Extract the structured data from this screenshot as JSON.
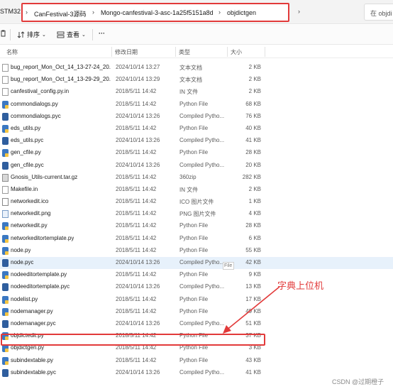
{
  "address": {
    "prefix": "STM32",
    "crumbs": [
      "CanFestival-3源码",
      "Mongo-canfestival-3-asc-1a25f5151a8d",
      "objdictgen"
    ],
    "search_placeholder": "在 objdi"
  },
  "toolbar": {
    "sort_label": "排序",
    "view_label": "查看",
    "more_label": "···"
  },
  "columns": {
    "name": "名称",
    "date": "修改日期",
    "type": "类型",
    "size": "大小"
  },
  "files": [
    {
      "name": "bug_report_Mon_Oct_14_13-27-24_20...",
      "date": "2024/10/14 13:27",
      "type": "文本文档",
      "size": "2 KB",
      "icon": "doc"
    },
    {
      "name": "bug_report_Mon_Oct_14_13-29-29_20...",
      "date": "2024/10/14 13:29",
      "type": "文本文档",
      "size": "2 KB",
      "icon": "doc"
    },
    {
      "name": "canfestival_config.py.in",
      "date": "2018/5/11 14:42",
      "type": "IN 文件",
      "size": "2 KB",
      "icon": "doc"
    },
    {
      "name": "commondialogs.py",
      "date": "2018/5/11 14:42",
      "type": "Python File",
      "size": "68 KB",
      "icon": "py"
    },
    {
      "name": "commondialogs.pyc",
      "date": "2024/10/14 13:26",
      "type": "Compiled Pytho...",
      "size": "76 KB",
      "icon": "pyc"
    },
    {
      "name": "eds_utils.py",
      "date": "2018/5/11 14:42",
      "type": "Python File",
      "size": "40 KB",
      "icon": "py"
    },
    {
      "name": "eds_utils.pyc",
      "date": "2024/10/14 13:26",
      "type": "Compiled Pytho...",
      "size": "41 KB",
      "icon": "pyc"
    },
    {
      "name": "gen_cfile.py",
      "date": "2018/5/11 14:42",
      "type": "Python File",
      "size": "28 KB",
      "icon": "py"
    },
    {
      "name": "gen_cfile.pyc",
      "date": "2024/10/14 13:26",
      "type": "Compiled Pytho...",
      "size": "20 KB",
      "icon": "pyc"
    },
    {
      "name": "Gnosis_Utils-current.tar.gz",
      "date": "2018/5/11 14:42",
      "type": "360zip",
      "size": "282 KB",
      "icon": "gz"
    },
    {
      "name": "Makefile.in",
      "date": "2018/5/11 14:42",
      "type": "IN 文件",
      "size": "2 KB",
      "icon": "doc"
    },
    {
      "name": "networkedit.ico",
      "date": "2018/5/11 14:42",
      "type": "ICO 图片文件",
      "size": "1 KB",
      "icon": "ico"
    },
    {
      "name": "networkedit.png",
      "date": "2018/5/11 14:42",
      "type": "PNG 图片文件",
      "size": "4 KB",
      "icon": "png"
    },
    {
      "name": "networkedit.py",
      "date": "2018/5/11 14:42",
      "type": "Python File",
      "size": "28 KB",
      "icon": "py"
    },
    {
      "name": "networkeditortemplate.py",
      "date": "2018/5/11 14:42",
      "type": "Python File",
      "size": "6 KB",
      "icon": "py"
    },
    {
      "name": "node.py",
      "date": "2018/5/11 14:42",
      "type": "Python File",
      "size": "55 KB",
      "icon": "py"
    },
    {
      "name": "node.pyc",
      "date": "2024/10/14 13:26",
      "type": "Compiled Pytho...",
      "size": "42 KB",
      "icon": "pyc"
    },
    {
      "name": "nodeeditortemplate.py",
      "date": "2018/5/11 14:42",
      "type": "Python File",
      "size": "9 KB",
      "icon": "py"
    },
    {
      "name": "nodeeditortemplate.pyc",
      "date": "2024/10/14 13:26",
      "type": "Compiled Pytho...",
      "size": "13 KB",
      "icon": "pyc"
    },
    {
      "name": "nodelist.py",
      "date": "2018/5/11 14:42",
      "type": "Python File",
      "size": "17 KB",
      "icon": "py"
    },
    {
      "name": "nodemanager.py",
      "date": "2018/5/11 14:42",
      "type": "Python File",
      "size": "49 KB",
      "icon": "py"
    },
    {
      "name": "nodemanager.pyc",
      "date": "2024/10/14 13:26",
      "type": "Compiled Pytho...",
      "size": "51 KB",
      "icon": "pyc"
    },
    {
      "name": "objdictedit.py",
      "date": "2018/5/11 14:42",
      "type": "Python File",
      "size": "37 KB",
      "icon": "py"
    },
    {
      "name": "objdictgen.py",
      "date": "2018/5/11 14:42",
      "type": "Python File",
      "size": "3 KB",
      "icon": "py"
    },
    {
      "name": "subindextable.py",
      "date": "2018/5/11 14:42",
      "type": "Python File",
      "size": "43 KB",
      "icon": "py"
    },
    {
      "name": "subindextable.pyc",
      "date": "2024/10/14 13:26",
      "type": "Compiled Pytho...",
      "size": "41 KB",
      "icon": "pyc"
    }
  ],
  "selected_row": 16,
  "hover_tooltip": "File",
  "annotation": {
    "text": "字典上位机",
    "color": "#e23a3a"
  },
  "watermark": "CSDN @过期橙子"
}
